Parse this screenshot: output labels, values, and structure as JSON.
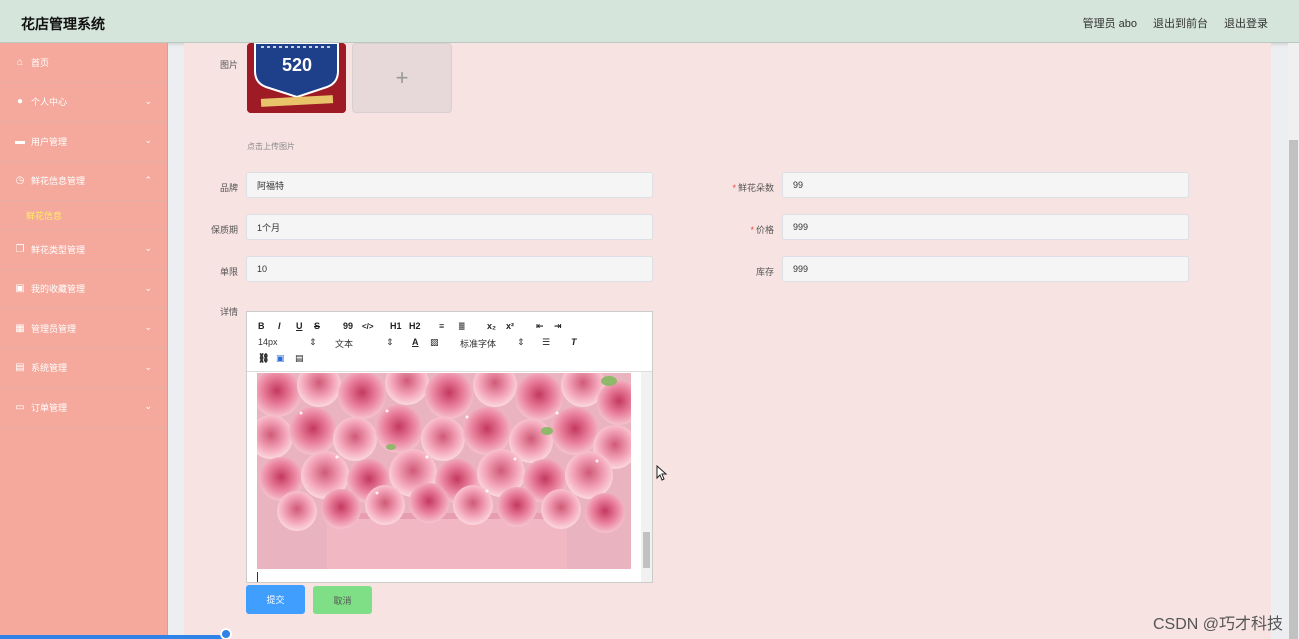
{
  "app": {
    "title": "花店管理系统"
  },
  "header": {
    "admin": "管理员 abo",
    "front": "退出到前台",
    "logout": "退出登录"
  },
  "sidebar": {
    "items": [
      {
        "label": "首页"
      },
      {
        "label": "个人中心"
      },
      {
        "label": "用户管理"
      },
      {
        "label": "鲜花信息管理"
      },
      {
        "label": "鲜花类型管理"
      },
      {
        "label": "我的收藏管理"
      },
      {
        "label": "管理员管理"
      },
      {
        "label": "系统管理"
      },
      {
        "label": "订单管理"
      }
    ],
    "sub": "鲜花信息"
  },
  "form": {
    "pic_label": "图片",
    "upload_hint": "点击上传图片",
    "pic_thumb_text": "520",
    "brand_label": "品牌",
    "brand_value": "阿福特",
    "count_label": "鲜花朵数",
    "count_value": "99",
    "shelf_label": "保质期",
    "shelf_value": "1个月",
    "price_label": "价格",
    "price_value": "999",
    "limit_label": "单限",
    "limit_value": "10",
    "stock_label": "库存",
    "stock_value": "999",
    "detail_label": "详情",
    "required_mark": "*"
  },
  "editor": {
    "bold": "B",
    "italic": "I",
    "underline": "U",
    "strike": "S",
    "quote": "99",
    "code": "</>",
    "h1": "H1",
    "h2": "H2",
    "sub": "x₂",
    "sup": "x²",
    "font_size": "14px",
    "text_type": "文本",
    "font_family": "标准字体",
    "font_color": "A"
  },
  "buttons": {
    "submit": "提交",
    "cancel": "取消"
  },
  "watermark": "CSDN @巧才科技"
}
